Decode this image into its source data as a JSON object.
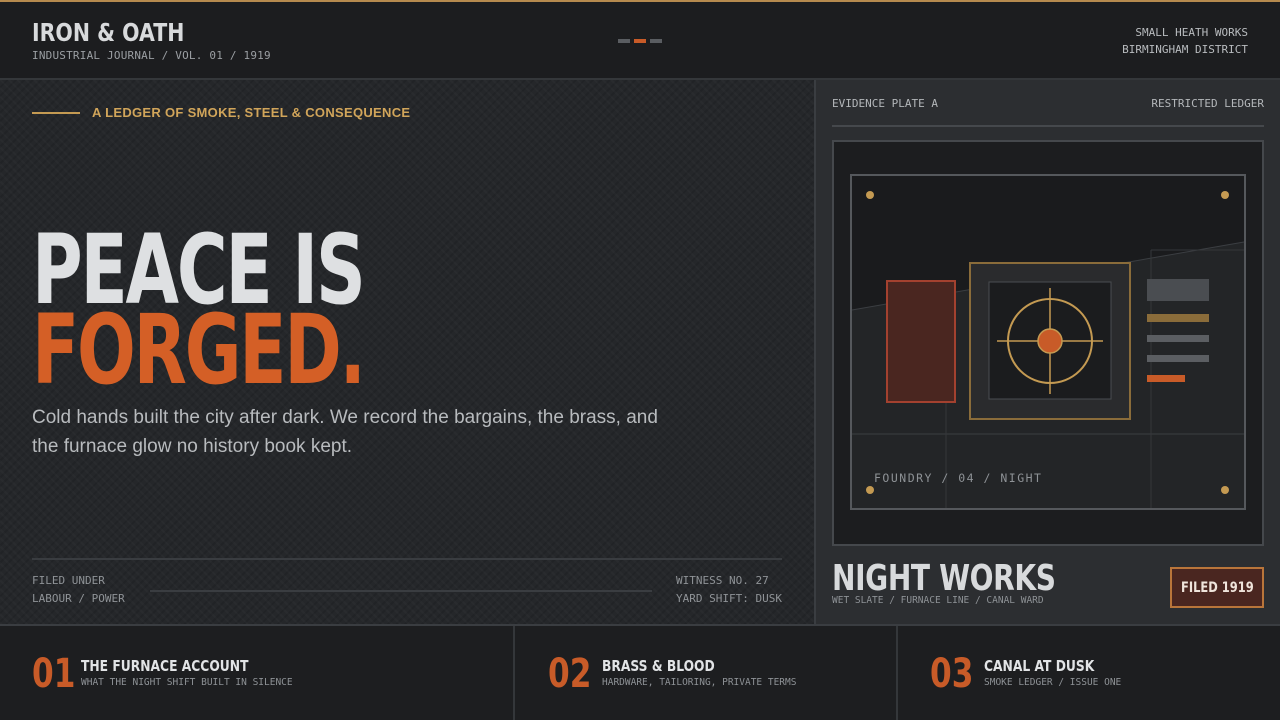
{
  "header": {
    "title": "IRON & OATH",
    "subtitle": "INDUSTRIAL JOURNAL / VOL. 01 / 1919",
    "location_line1": "SMALL HEATH WORKS",
    "location_line2": "BIRMINGHAM DISTRICT",
    "pager": {
      "count": 3,
      "active_index": 1
    }
  },
  "hero": {
    "eyebrow": "A LEDGER OF SMOKE, STEEL & CONSEQUENCE",
    "headline_line1": "PEACE IS",
    "headline_line2": "FORGED.",
    "lede": "Cold hands built the city after dark. We record the bargains, the brass, and the furnace glow no history book kept.",
    "filed_under_label": "FILED UNDER",
    "filed_under_value": "LABOUR / POWER",
    "witness": "WITNESS NO. 27",
    "shift": "YARD SHIFT: DUSK"
  },
  "evidence": {
    "plate_label": "EVIDENCE PLATE A",
    "ledger_label": "RESTRICTED LEDGER",
    "plate_caption": "FOUNDRY / 04 / NIGHT",
    "title": "NIGHT WORKS",
    "subtitle": "WET SLATE / FURNACE LINE / CANAL WARD",
    "badge": "FILED 1919"
  },
  "features": [
    {
      "number": "01",
      "title": "THE FURNACE ACCOUNT",
      "subtitle": "WHAT THE NIGHT SHIFT BUILT IN SILENCE"
    },
    {
      "number": "02",
      "title": "BRASS & BLOOD",
      "subtitle": "HARDWARE, TAILORING, PRIVATE TERMS"
    },
    {
      "number": "03",
      "title": "CANAL AT DUSK",
      "subtitle": "SMOKE LEDGER / ISSUE ONE"
    }
  ],
  "colors": {
    "accent_orange": "#c85b28",
    "accent_gold": "#c49a52",
    "background": "#1c1d1f"
  }
}
